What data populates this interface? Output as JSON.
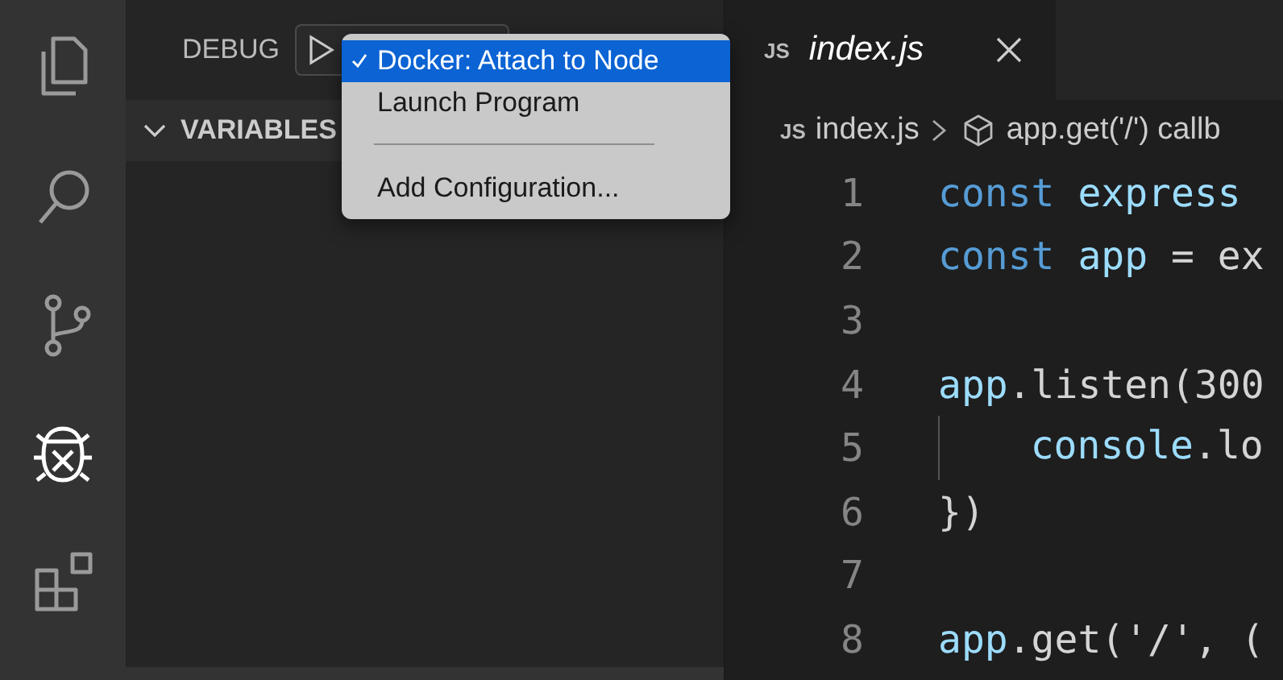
{
  "activity_bar": {
    "items": [
      {
        "kind": "files",
        "selected": false
      },
      {
        "kind": "search",
        "selected": false
      },
      {
        "kind": "branch",
        "selected": false
      },
      {
        "kind": "debug",
        "selected": true
      },
      {
        "kind": "extensions",
        "selected": false
      }
    ]
  },
  "sidebar": {
    "title": "DEBUG",
    "sections": [
      {
        "title": "VARIABLES",
        "expanded": true
      }
    ]
  },
  "debug_menu": {
    "items": [
      {
        "kind": "item",
        "label": "Docker: Attach to Node",
        "checked": true,
        "selected": true
      },
      {
        "kind": "item",
        "label": "Launch Program",
        "checked": false,
        "selected": false
      },
      {
        "kind": "separator"
      },
      {
        "kind": "item",
        "label": "Add Configuration...",
        "checked": false,
        "selected": false
      }
    ]
  },
  "editor": {
    "tabs": [
      {
        "badge": "JS",
        "label": "index.js",
        "selected": true
      }
    ],
    "breadcrumb": [
      {
        "badge": "JS",
        "label": "index.js"
      },
      {
        "label": "app.get('/') callb"
      }
    ],
    "lines": [
      {
        "number": "1",
        "tokens": [
          {
            "text": "const",
            "kind": "keyword"
          },
          {
            "text": " express",
            "kind": "variable"
          }
        ]
      },
      {
        "number": "2",
        "tokens": [
          {
            "text": "const",
            "kind": "keyword"
          },
          {
            "text": " app",
            "kind": "variable"
          },
          {
            "text": " = ex",
            "kind": "plain"
          }
        ]
      },
      {
        "number": "3"
      },
      {
        "number": "4",
        "tokens": [
          {
            "text": "app",
            "kind": "variable"
          },
          {
            "text": ".listen(300",
            "kind": "plain"
          }
        ]
      },
      {
        "number": "5",
        "indented": true,
        "tokens": [
          {
            "text": "console",
            "kind": "variable"
          },
          {
            "text": ".lo",
            "kind": "plain"
          }
        ]
      },
      {
        "number": "6",
        "tokens": [
          {
            "text": "})",
            "kind": "plain"
          }
        ]
      },
      {
        "number": "7"
      },
      {
        "number": "8",
        "tokens": [
          {
            "text": "app",
            "kind": "variable"
          },
          {
            "text": ".get('/', (",
            "kind": "plain"
          }
        ]
      }
    ]
  }
}
